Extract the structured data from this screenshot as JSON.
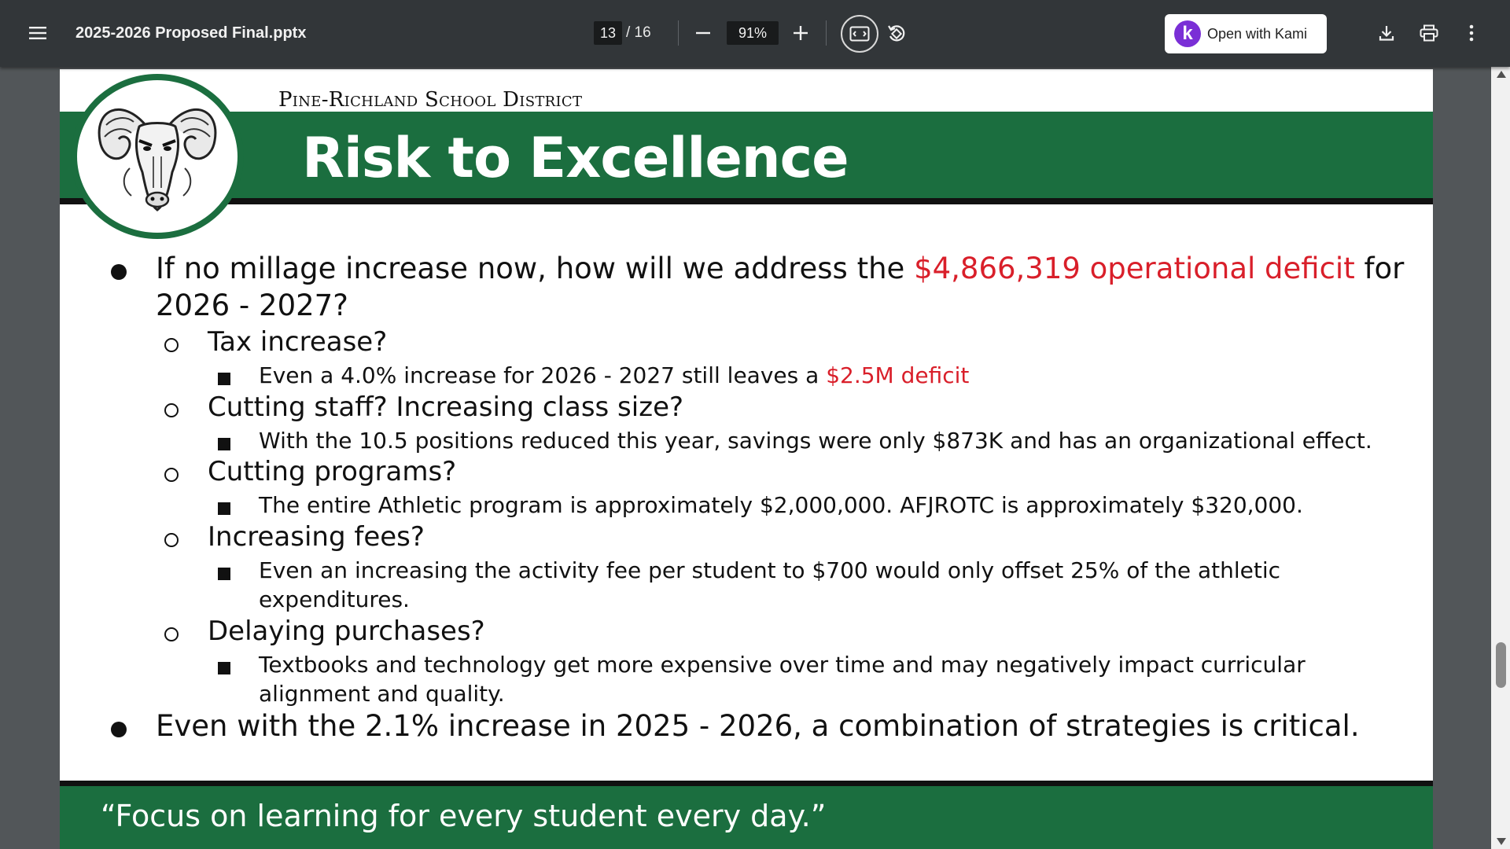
{
  "toolbar": {
    "menu_icon": "hamburger-menu-icon",
    "file_name": "2025-2026 Proposed Final.pptx",
    "current_page": "13",
    "page_total": "/ 16",
    "zoom_out_icon": "minus-icon",
    "zoom_value": "91%",
    "zoom_in_icon": "plus-icon",
    "fit_icon": "fit-to-page-icon",
    "rotate_icon": "rotate-icon",
    "kami_letter": "k",
    "kami_label": "Open with Kami",
    "download_icon": "download-icon",
    "print_icon": "print-icon",
    "more_icon": "more-vertical-icon"
  },
  "slide": {
    "district": "Pine-Richland School District",
    "title": "Risk to Excellence",
    "colors": {
      "green": "#1b6e3f",
      "red": "#d91f2a"
    },
    "q1_pre": "If no millage increase now, how will we address the ",
    "q1_red": "$4,866,319 operational deficit",
    "q1_post": " for",
    "q1_line2": "2026 - 2027?",
    "s1": "Tax increase?",
    "s1_detail_pre": "Even a 4.0% increase for 2026 - 2027 still leaves a ",
    "s1_detail_red": "$2.5M deficit",
    "s2": "Cutting staff? Increasing class size?",
    "s2_detail": "With the 10.5 positions reduced this year, savings were only $873K and has an organizational effect.",
    "s3": "Cutting programs?",
    "s3_detail": "The entire Athletic program is approximately $2,000,000. AFJROTC is approximately $320,000.",
    "s4": "Increasing fees?",
    "s4_detail_line1": "Even an increasing the activity fee per student to $700 would only offset 25% of the athletic",
    "s4_detail_line2": "expenditures.",
    "s5": "Delaying purchases?",
    "s5_detail_line1": "Textbooks and technology get more expensive over time and may negatively impact curricular",
    "s5_detail_line2": "alignment and quality.",
    "conclusion": "Even with the 2.1% increase in 2025 - 2026, a combination of strategies is critical.",
    "footer": "“Focus on learning for every student every day.”"
  }
}
